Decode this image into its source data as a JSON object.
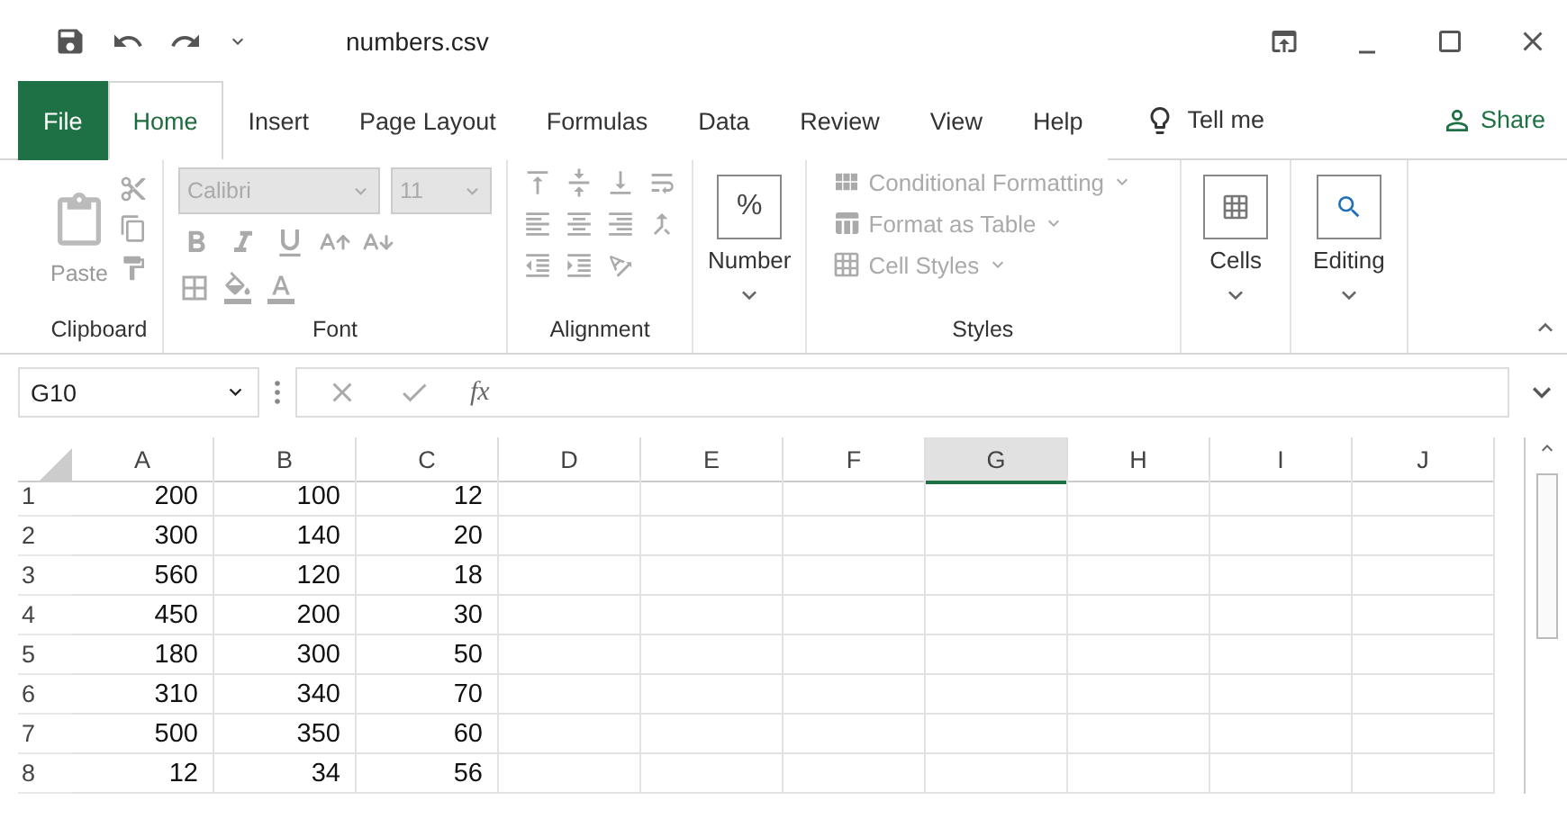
{
  "window": {
    "title": "numbers.csv"
  },
  "tabs": [
    {
      "label": "File",
      "kind": "backstage",
      "selected": false
    },
    {
      "label": "Home",
      "kind": "tab",
      "selected": true
    },
    {
      "label": "Insert",
      "kind": "tab",
      "selected": false
    },
    {
      "label": "Page Layout",
      "kind": "tab",
      "selected": false
    },
    {
      "label": "Formulas",
      "kind": "tab",
      "selected": false
    },
    {
      "label": "Data",
      "kind": "tab",
      "selected": false
    },
    {
      "label": "Review",
      "kind": "tab",
      "selected": false
    },
    {
      "label": "View",
      "kind": "tab",
      "selected": false
    },
    {
      "label": "Help",
      "kind": "tab",
      "selected": false
    }
  ],
  "tell_me": "Tell me",
  "share": "Share",
  "ribbon": {
    "clipboard": {
      "paste": "Paste",
      "label": "Clipboard"
    },
    "font": {
      "name": "Calibri",
      "size": "11",
      "label": "Font"
    },
    "alignment": {
      "label": "Alignment"
    },
    "number": {
      "symbol": "%",
      "label": "Number"
    },
    "styles": {
      "items": [
        "Conditional Formatting",
        "Format as Table",
        "Cell Styles"
      ],
      "label": "Styles"
    },
    "cells": {
      "label": "Cells"
    },
    "editing": {
      "label": "Editing"
    }
  },
  "formula_bar": {
    "name_box": "G10",
    "fx": "fx"
  },
  "sheet": {
    "columns": [
      {
        "label": "A",
        "selected": false
      },
      {
        "label": "B",
        "selected": false
      },
      {
        "label": "C",
        "selected": false
      },
      {
        "label": "D",
        "selected": false
      },
      {
        "label": "E",
        "selected": false
      },
      {
        "label": "F",
        "selected": false
      },
      {
        "label": "G",
        "selected": true
      },
      {
        "label": "H",
        "selected": false
      },
      {
        "label": "I",
        "selected": false
      },
      {
        "label": "J",
        "selected": false
      }
    ],
    "rows": [
      {
        "number": "1",
        "cells": [
          "200",
          "100",
          "12"
        ]
      },
      {
        "number": "2",
        "cells": [
          "300",
          "140",
          "20"
        ]
      },
      {
        "number": "3",
        "cells": [
          "560",
          "120",
          "18"
        ]
      },
      {
        "number": "4",
        "cells": [
          "450",
          "200",
          "30"
        ]
      },
      {
        "number": "5",
        "cells": [
          "180",
          "300",
          "50"
        ]
      },
      {
        "number": "6",
        "cells": [
          "310",
          "340",
          "70"
        ]
      },
      {
        "number": "7",
        "cells": [
          "500",
          "350",
          "60"
        ]
      },
      {
        "number": "8",
        "cells": [
          "12",
          "34",
          "56"
        ]
      }
    ]
  }
}
